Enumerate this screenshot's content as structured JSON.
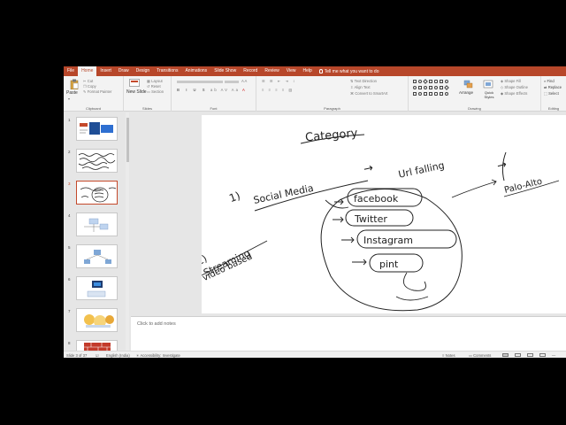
{
  "menu": {
    "tabs": [
      "File",
      "Home",
      "Insert",
      "Draw",
      "Design",
      "Transitions",
      "Animations",
      "Slide Show",
      "Record",
      "Review",
      "View",
      "Help"
    ],
    "active_tab": "Home",
    "tell_me": "Tell me what you want to do"
  },
  "ribbon": {
    "clipboard": {
      "paste": "Paste",
      "cut": "Cut",
      "copy": "Copy",
      "format_painter": "Format Painter",
      "label": "Clipboard"
    },
    "slides": {
      "new_slide": "New Slide",
      "layout": "Layout",
      "reset": "Reset",
      "section": "Section",
      "label": "Slides"
    },
    "font": {
      "label": "Font"
    },
    "paragraph": {
      "text_direction": "Text Direction",
      "align_text": "Align Text",
      "smartart": "Convert to SmartArt",
      "label": "Paragraph"
    },
    "drawing": {
      "arrange": "Arrange",
      "quick_styles": "Quick Styles",
      "shape_fill": "Shape Fill",
      "shape_outline": "Shape Outline",
      "shape_effects": "Shape Effects",
      "label": "Drawing"
    },
    "editing": {
      "find": "Find",
      "replace": "Replace",
      "select": "Select",
      "label": "Editing"
    }
  },
  "thumbnails": {
    "numbers": [
      "1",
      "2",
      "3",
      "4",
      "5",
      "6",
      "7",
      "8"
    ],
    "selected": "3"
  },
  "slide": {
    "title": "Category",
    "n1": "1)",
    "social_media": "Social Media",
    "arrow": "→",
    "url_falling": "Url falling",
    "palo_alto": "Palo-Alto",
    "n2": "2)",
    "streaming": "Streaming",
    "video_based": "video based",
    "facebook": "facebook",
    "twitter": "Twitter",
    "instagram": "Instagram",
    "pint": "pint"
  },
  "notes": {
    "placeholder": "Click to add notes"
  },
  "status": {
    "slide_count": "Slide 3 of 37",
    "language": "English (India)",
    "accessibility": "Accessibility: Investigate",
    "notes": "Notes",
    "comments": "Comments"
  },
  "colors": {
    "accent": "#b7472a",
    "selected_thumb": "#c4492b"
  }
}
